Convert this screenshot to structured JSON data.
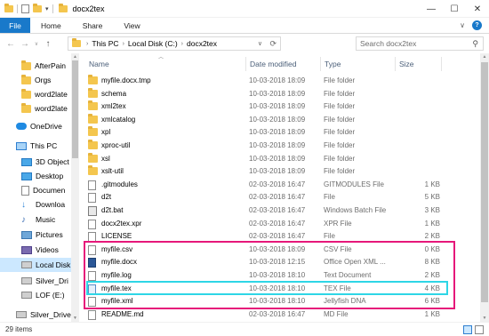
{
  "window": {
    "title": "docx2tex",
    "controls": {
      "minimize": "—",
      "maximize": "☐",
      "close": "✕"
    }
  },
  "ribbon": {
    "tabs": [
      "File",
      "Home",
      "Share",
      "View"
    ],
    "collapse_glyph": "∨",
    "help_glyph": "?"
  },
  "address": {
    "crumbs": [
      "This PC",
      "Local Disk (C:)",
      "docx2tex"
    ],
    "search_placeholder": "Search docx2tex"
  },
  "nav": {
    "items": [
      {
        "label": "AfterPain",
        "icon": "folder-icon",
        "indent": 1,
        "selected": false
      },
      {
        "label": "Orgs",
        "icon": "folder-icon",
        "indent": 1,
        "selected": false
      },
      {
        "label": "word2late",
        "icon": "folder-icon",
        "indent": 1,
        "selected": false
      },
      {
        "label": "word2late",
        "icon": "folder-icon",
        "indent": 1,
        "selected": false
      },
      {
        "label": "OneDrive",
        "icon": "cloud-icon",
        "indent": 0,
        "selected": false
      },
      {
        "label": "This PC",
        "icon": "computer-icon",
        "indent": 0,
        "selected": false
      },
      {
        "label": "3D Object",
        "icon": "objects-3d-icon",
        "indent": 1,
        "selected": false
      },
      {
        "label": "Desktop",
        "icon": "desktop-icon",
        "indent": 1,
        "selected": false
      },
      {
        "label": "Documen",
        "icon": "documents-icon",
        "indent": 1,
        "selected": false
      },
      {
        "label": "Downloa",
        "icon": "download-icon",
        "indent": 1,
        "selected": false
      },
      {
        "label": "Music",
        "icon": "music-icon",
        "indent": 1,
        "selected": false
      },
      {
        "label": "Pictures",
        "icon": "pictures-icon",
        "indent": 1,
        "selected": false
      },
      {
        "label": "Videos",
        "icon": "videos-icon",
        "indent": 1,
        "selected": false
      },
      {
        "label": "Local Disk",
        "icon": "disk-icon",
        "indent": 1,
        "selected": true
      },
      {
        "label": "Silver_Dri",
        "icon": "disk-icon",
        "indent": 1,
        "selected": false
      },
      {
        "label": "LOF (E:)",
        "icon": "disk-icon",
        "indent": 1,
        "selected": false
      },
      {
        "label": "Silver_Drive",
        "icon": "disk-icon",
        "indent": 0,
        "selected": false
      }
    ]
  },
  "columns": {
    "name": "Name",
    "date": "Date modified",
    "type": "Type",
    "size": "Size"
  },
  "files": [
    {
      "name": "myfile.docx.tmp",
      "date": "10-03-2018 18:09",
      "type": "File folder",
      "size": "",
      "icon": "folder-icon"
    },
    {
      "name": "schema",
      "date": "10-03-2018 18:09",
      "type": "File folder",
      "size": "",
      "icon": "folder-icon"
    },
    {
      "name": "xml2tex",
      "date": "10-03-2018 18:09",
      "type": "File folder",
      "size": "",
      "icon": "folder-icon"
    },
    {
      "name": "xmlcatalog",
      "date": "10-03-2018 18:09",
      "type": "File folder",
      "size": "",
      "icon": "folder-icon"
    },
    {
      "name": "xpl",
      "date": "10-03-2018 18:09",
      "type": "File folder",
      "size": "",
      "icon": "folder-icon"
    },
    {
      "name": "xproc-util",
      "date": "10-03-2018 18:09",
      "type": "File folder",
      "size": "",
      "icon": "folder-icon"
    },
    {
      "name": "xsl",
      "date": "10-03-2018 18:09",
      "type": "File folder",
      "size": "",
      "icon": "folder-icon"
    },
    {
      "name": "xslt-util",
      "date": "10-03-2018 18:09",
      "type": "File folder",
      "size": "",
      "icon": "folder-icon"
    },
    {
      "name": ".gitmodules",
      "date": "02-03-2018 16:47",
      "type": "GITMODULES File",
      "size": "1 KB",
      "icon": "file-icon"
    },
    {
      "name": "d2t",
      "date": "02-03-2018 16:47",
      "type": "File",
      "size": "5 KB",
      "icon": "file-icon"
    },
    {
      "name": "d2t.bat",
      "date": "02-03-2018 16:47",
      "type": "Windows Batch File",
      "size": "3 KB",
      "icon": "batch-file-icon"
    },
    {
      "name": "docx2tex.xpr",
      "date": "02-03-2018 16:47",
      "type": "XPR File",
      "size": "1 KB",
      "icon": "file-icon"
    },
    {
      "name": "LICENSE",
      "date": "02-03-2018 16:47",
      "type": "File",
      "size": "2 KB",
      "icon": "file-icon"
    },
    {
      "name": "myfile.csv",
      "date": "10-03-2018 18:09",
      "type": "CSV File",
      "size": "0 KB",
      "icon": "file-icon"
    },
    {
      "name": "myfile.docx",
      "date": "10-03-2018 12:15",
      "type": "Office Open XML ...",
      "size": "8 KB",
      "icon": "word-doc-icon"
    },
    {
      "name": "myfile.log",
      "date": "10-03-2018 18:10",
      "type": "Text Document",
      "size": "2 KB",
      "icon": "file-icon"
    },
    {
      "name": "myfile.tex",
      "date": "10-03-2018 18:10",
      "type": "TEX File",
      "size": "4 KB",
      "icon": "tex-file-icon"
    },
    {
      "name": "myfile.xml",
      "date": "10-03-2018 18:10",
      "type": "Jellyfish DNA",
      "size": "6 KB",
      "icon": "file-icon"
    },
    {
      "name": "README.md",
      "date": "02-03-2018 16:47",
      "type": "MD File",
      "size": "1 KB",
      "icon": "file-icon"
    }
  ],
  "status": {
    "item_count": "29 items"
  }
}
